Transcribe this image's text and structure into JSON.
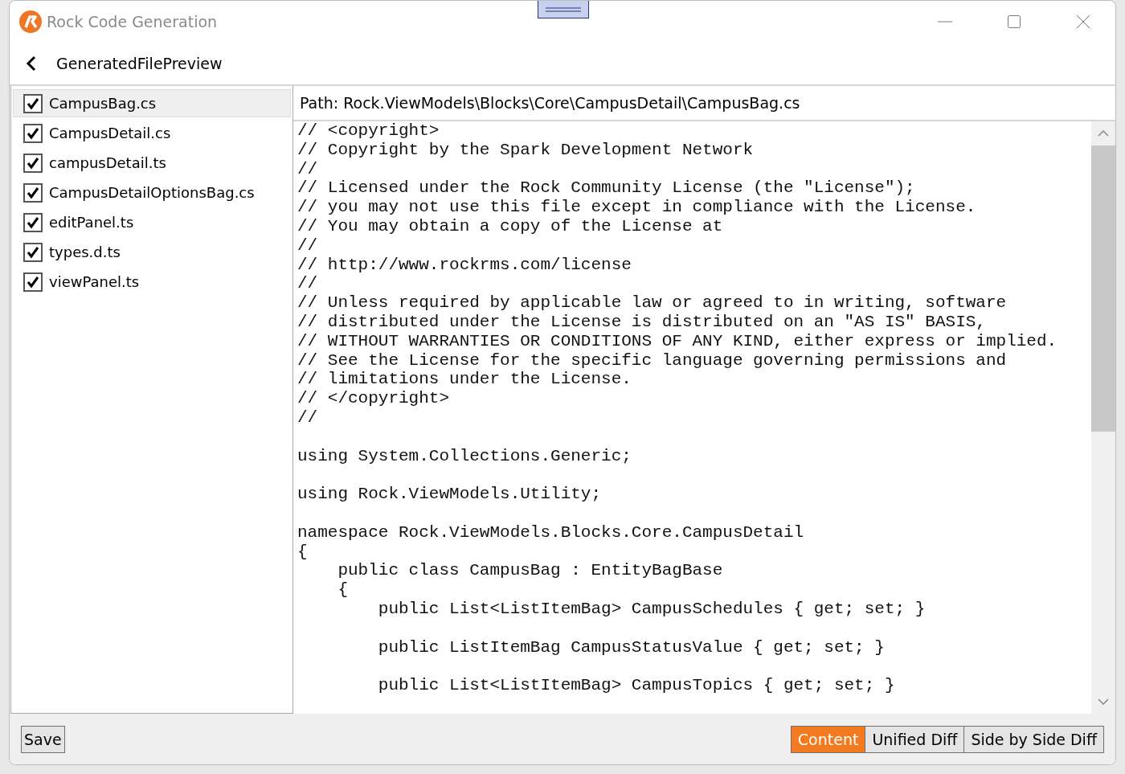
{
  "window": {
    "title": "Rock Code Generation"
  },
  "header": {
    "title": "GeneratedFilePreview"
  },
  "files": [
    {
      "name": "CampusBag.cs",
      "checked": true,
      "selected": true
    },
    {
      "name": "CampusDetail.cs",
      "checked": true,
      "selected": false
    },
    {
      "name": "campusDetail.ts",
      "checked": true,
      "selected": false
    },
    {
      "name": "CampusDetailOptionsBag.cs",
      "checked": true,
      "selected": false
    },
    {
      "name": "editPanel.ts",
      "checked": true,
      "selected": false
    },
    {
      "name": "types.d.ts",
      "checked": true,
      "selected": false
    },
    {
      "name": "viewPanel.ts",
      "checked": true,
      "selected": false
    }
  ],
  "path": "Path: Rock.ViewModels\\Blocks\\Core\\CampusDetail\\CampusBag.cs",
  "code_blocks": [
    [
      "// <copyright>",
      "// Copyright by the Spark Development Network",
      "//",
      "// Licensed under the Rock Community License (the \"License\");",
      "// you may not use this file except in compliance with the License.",
      "// You may obtain a copy of the License at",
      "//",
      "// http://www.rockrms.com/license",
      "//",
      "// Unless required by applicable law or agreed to in writing, software",
      "// distributed under the License is distributed on an \"AS IS\" BASIS,",
      "// WITHOUT WARRANTIES OR CONDITIONS OF ANY KIND, either express or implied.",
      "// See the License for the specific language governing permissions and",
      "// limitations under the License.",
      "// </copyright>",
      "//"
    ],
    [
      "using System.Collections.Generic;"
    ],
    [
      "using Rock.ViewModels.Utility;"
    ],
    [
      "namespace Rock.ViewModels.Blocks.Core.CampusDetail",
      "{",
      "    public class CampusBag : EntityBagBase",
      "    {",
      "        public List<ListItemBag> CampusSchedules { get; set; }"
    ],
    [
      "        public ListItemBag CampusStatusValue { get; set; }"
    ],
    [
      "        public List<ListItemBag> CampusTopics { get; set; }"
    ]
  ],
  "save_button": "Save",
  "view_tabs": [
    {
      "label": "Content",
      "selected": true
    },
    {
      "label": "Unified Diff",
      "selected": false
    },
    {
      "label": "Side by Side Diff",
      "selected": false
    }
  ]
}
